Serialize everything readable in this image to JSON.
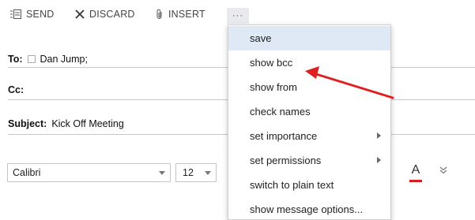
{
  "toolbar": {
    "send": "SEND",
    "discard": "DISCARD",
    "insert": "INSERT",
    "more": "···"
  },
  "compose": {
    "to_label": "To:",
    "to_value": "Dan Jump;",
    "cc_label": "Cc:",
    "subject_label": "Subject:",
    "subject_value": "Kick Off Meeting"
  },
  "format": {
    "font": "Calibri",
    "size": "12",
    "color_glyph": "A",
    "more_glyph": "»",
    "font_color": "#d62020"
  },
  "menu": {
    "items": [
      {
        "label": "save"
      },
      {
        "label": "show bcc"
      },
      {
        "label": "show from"
      },
      {
        "label": "check names"
      },
      {
        "label": "set importance"
      },
      {
        "label": "set permissions"
      },
      {
        "label": "switch to plain text"
      },
      {
        "label": "show message options..."
      }
    ],
    "highlight_color": "#dfe9f5"
  },
  "annotation": {
    "arrow_color": "#e02020"
  }
}
